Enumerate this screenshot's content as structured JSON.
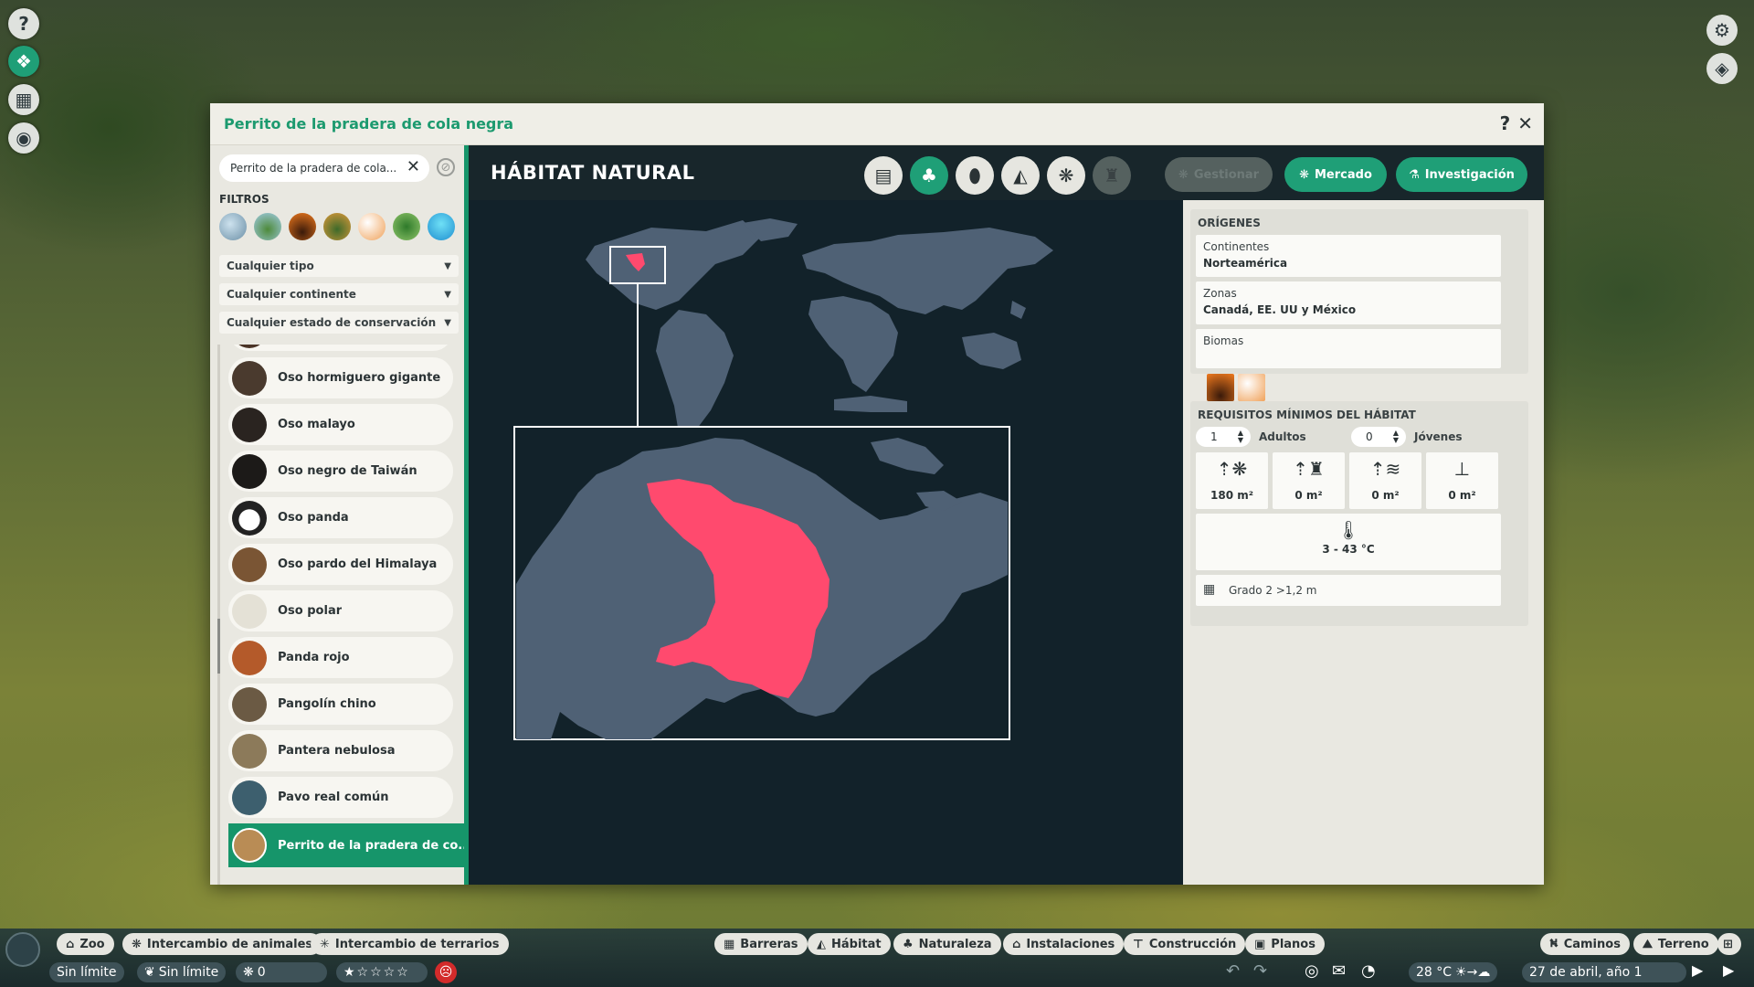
{
  "window": {
    "title": "Perrito de la pradera de cola negra",
    "help": "?",
    "close": "✕"
  },
  "left": {
    "search_value": "Perrito de la pradera de cola...",
    "filters_label": "FILTROS",
    "dropdowns": [
      "Cualquier tipo",
      "Cualquier continente",
      "Cualquier estado de conservación"
    ],
    "animals": [
      {
        "label": "Oso hormiguero gigante",
        "color": "#4a3a2e"
      },
      {
        "label": "Oso malayo",
        "color": "#2a2420"
      },
      {
        "label": "Oso negro de Taiwán",
        "color": "#1c1a18"
      },
      {
        "label": "Oso panda",
        "color": "#e8e8e2"
      },
      {
        "label": "Oso pardo del Himalaya",
        "color": "#7a5534"
      },
      {
        "label": "Oso polar",
        "color": "#ece9df"
      },
      {
        "label": "Panda rojo",
        "color": "#b45a2a"
      },
      {
        "label": "Pangolín chino",
        "color": "#6b5a44"
      },
      {
        "label": "Pantera nebulosa",
        "color": "#8c7a5a"
      },
      {
        "label": "Pavo real común",
        "color": "#3d5f6e"
      },
      {
        "label": "Perrito de la pradera de co...",
        "color": "#b98c55"
      }
    ]
  },
  "main": {
    "heading": "HÁBITAT NATURAL",
    "tabs": [
      "clipboard-icon",
      "habitat-tree-icon",
      "food-sack-icon",
      "enrichment-icon",
      "paw-icon",
      "trophy-icon"
    ],
    "buttons": {
      "manage": "Gestionar",
      "market": "Mercado",
      "research": "Investigación"
    }
  },
  "origins": {
    "heading": "ORÍGENES",
    "continents_label": "Continentes",
    "continents_value": "Norteamérica",
    "zones_label": "Zonas",
    "zones_value": "Canadá, EE. UU y México",
    "biomes_label": "Biomas"
  },
  "requirements": {
    "heading": "REQUISITOS MÍNIMOS DEL HÁBITAT",
    "adults_value": "1",
    "adults_label": "Adultos",
    "young_value": "0",
    "young_label": "Jóvenes",
    "land": "180  m²",
    "climb": "0  m²",
    "water": "0  m²",
    "deep": "0  m²",
    "temperature": "3 - 43 °C",
    "barrier": "Grado 2 >1,2 m"
  },
  "bottom": {
    "left_tabs": [
      "Zoo",
      "Intercambio de animales",
      "Intercambio de terrarios"
    ],
    "mid_tabs": [
      "Barreras",
      "Hábitat",
      "Naturaleza",
      "Instalaciones",
      "Construcción",
      "Planos"
    ],
    "right_tabs": [
      "Caminos",
      "Terreno"
    ],
    "money": "Sin límite",
    "research": "Sin límite",
    "guests": "0",
    "temperature": "28 °C",
    "date": "27 de abril, año 1"
  }
}
